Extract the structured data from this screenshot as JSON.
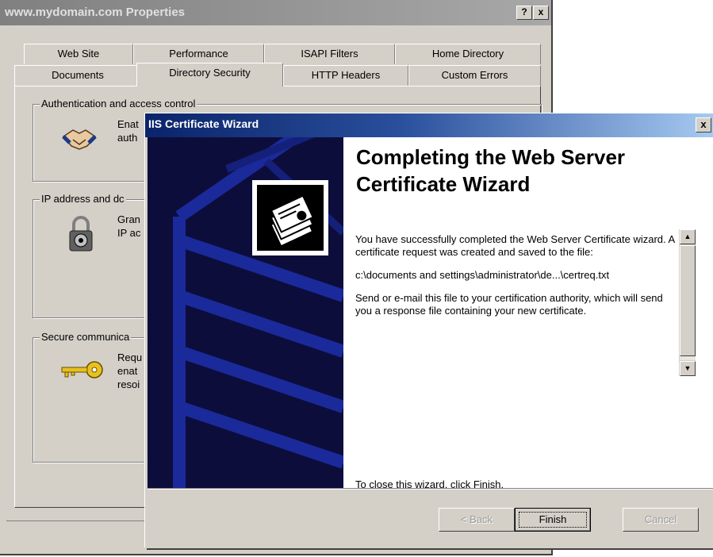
{
  "props": {
    "title": "www.mydomain.com Properties",
    "help_label": "?",
    "close_label": "x",
    "tabs_row1": [
      "Web Site",
      "Performance",
      "ISAPI Filters",
      "Home Directory"
    ],
    "tabs_row2": [
      "Documents",
      "Directory Security",
      "HTTP Headers",
      "Custom Errors"
    ],
    "selected_tab": "Directory Security",
    "groups": {
      "auth": {
        "legend": "Authentication and access control",
        "line1": "Enat",
        "line2": "auth"
      },
      "ip": {
        "legend": "IP address and dc",
        "line1": "Gran",
        "line2": "IP ac"
      },
      "secure": {
        "legend": "Secure communica",
        "line1": "Requ",
        "line2": "enat",
        "line3": "resoi"
      }
    }
  },
  "wizard": {
    "title": "IIS Certificate Wizard",
    "close_label": "x",
    "heading_line1": "Completing the Web Server",
    "heading_line2": "Certificate Wizard",
    "para1": "You have successfully completed the Web Server Certificate wizard. A certificate request was created and saved to the file:",
    "para2": "c:\\documents and settings\\administrator\\de...\\certreq.txt",
    "para3": "Send or e-mail this file to your certification authority, which will send you a response file containing your new certificate.",
    "close_hint": "To close this wizard, click Finish.",
    "buttons": {
      "back": "< Back",
      "finish": "Finish",
      "cancel": "Cancel"
    }
  }
}
